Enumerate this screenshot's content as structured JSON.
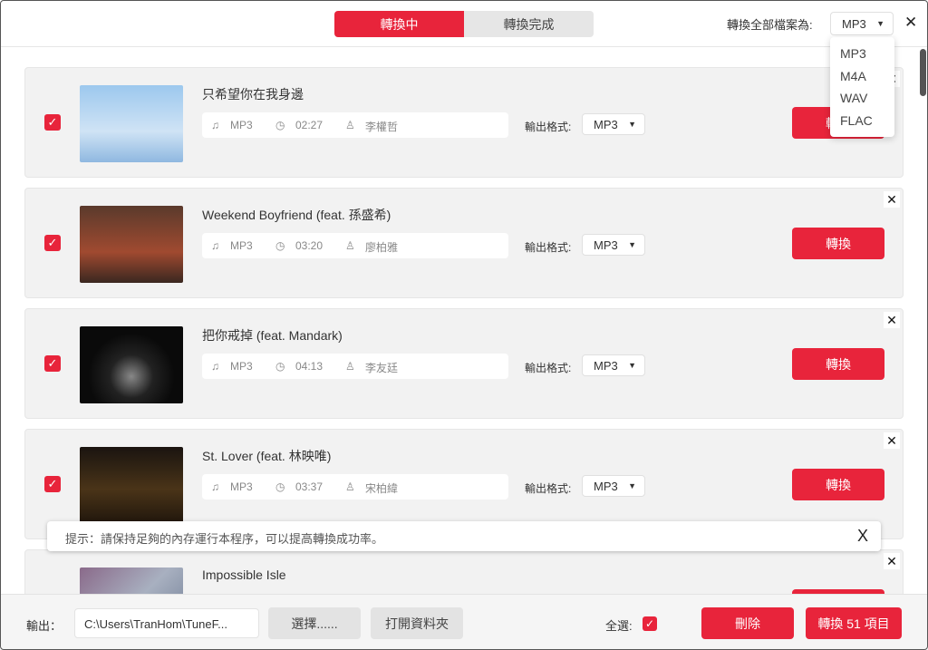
{
  "header": {
    "tabs": [
      {
        "label": "轉換中",
        "active": true
      },
      {
        "label": "轉換完成",
        "active": false
      }
    ],
    "convert_all_label": "轉換全部檔案為:",
    "convert_all_value": "MP3",
    "close": "✕"
  },
  "dropdown": {
    "options": [
      "MP3",
      "M4A",
      "WAV",
      "FLAC"
    ]
  },
  "format_label": "輸出格式:",
  "convert_label": "轉換",
  "colors": {
    "accent": "#e8243b"
  },
  "songs": [
    {
      "title": "只希望你在我身邊",
      "format": "MP3",
      "duration": "02:27",
      "artist": "李權哲",
      "output": "MP3",
      "checked": true,
      "thumb": "linear-gradient(#9cc8ee,#cfe3f5 60%,#8fb8e0)"
    },
    {
      "title": "Weekend Boyfriend (feat. 孫盛希)",
      "format": "MP3",
      "duration": "03:20",
      "artist": "廖柏雅",
      "output": "MP3",
      "checked": true,
      "thumb": "linear-gradient(#5a3a2c,#a04a30 60%,#3a2820)"
    },
    {
      "title": "把你戒掉 (feat. Mandark)",
      "format": "MP3",
      "duration": "04:13",
      "artist": "李友廷",
      "output": "MP3",
      "checked": true,
      "thumb": "radial-gradient(circle at 50% 65%,#888 0,#222 30%,#0a0a0a 60%)"
    },
    {
      "title": "St. Lover (feat. 林映唯)",
      "format": "MP3",
      "duration": "03:37",
      "artist": "宋柏緯",
      "output": "MP3",
      "checked": true,
      "thumb": "linear-gradient(#1a1410,#4a3418 55%,#20160c)"
    },
    {
      "title": "Impossible Isle",
      "format": "",
      "duration": "",
      "artist": "",
      "output": "",
      "checked": true,
      "thumb": "linear-gradient(135deg,#8a6a8a,#a8b0c0 50%,#6a7890)"
    }
  ],
  "toast": {
    "text": "提示：請保持足夠的內存運行本程序，可以提高轉換成功率。",
    "close": "X"
  },
  "footer": {
    "output_label": "輸出：",
    "output_path": "C:\\Users\\TranHom\\TuneF...",
    "choose_label": "選擇......",
    "open_folder_label": "打開資料夾",
    "select_all_label": "全選:",
    "select_all_checked": true,
    "delete_label": "刪除",
    "convert_items_label": "轉換 51 項目"
  }
}
